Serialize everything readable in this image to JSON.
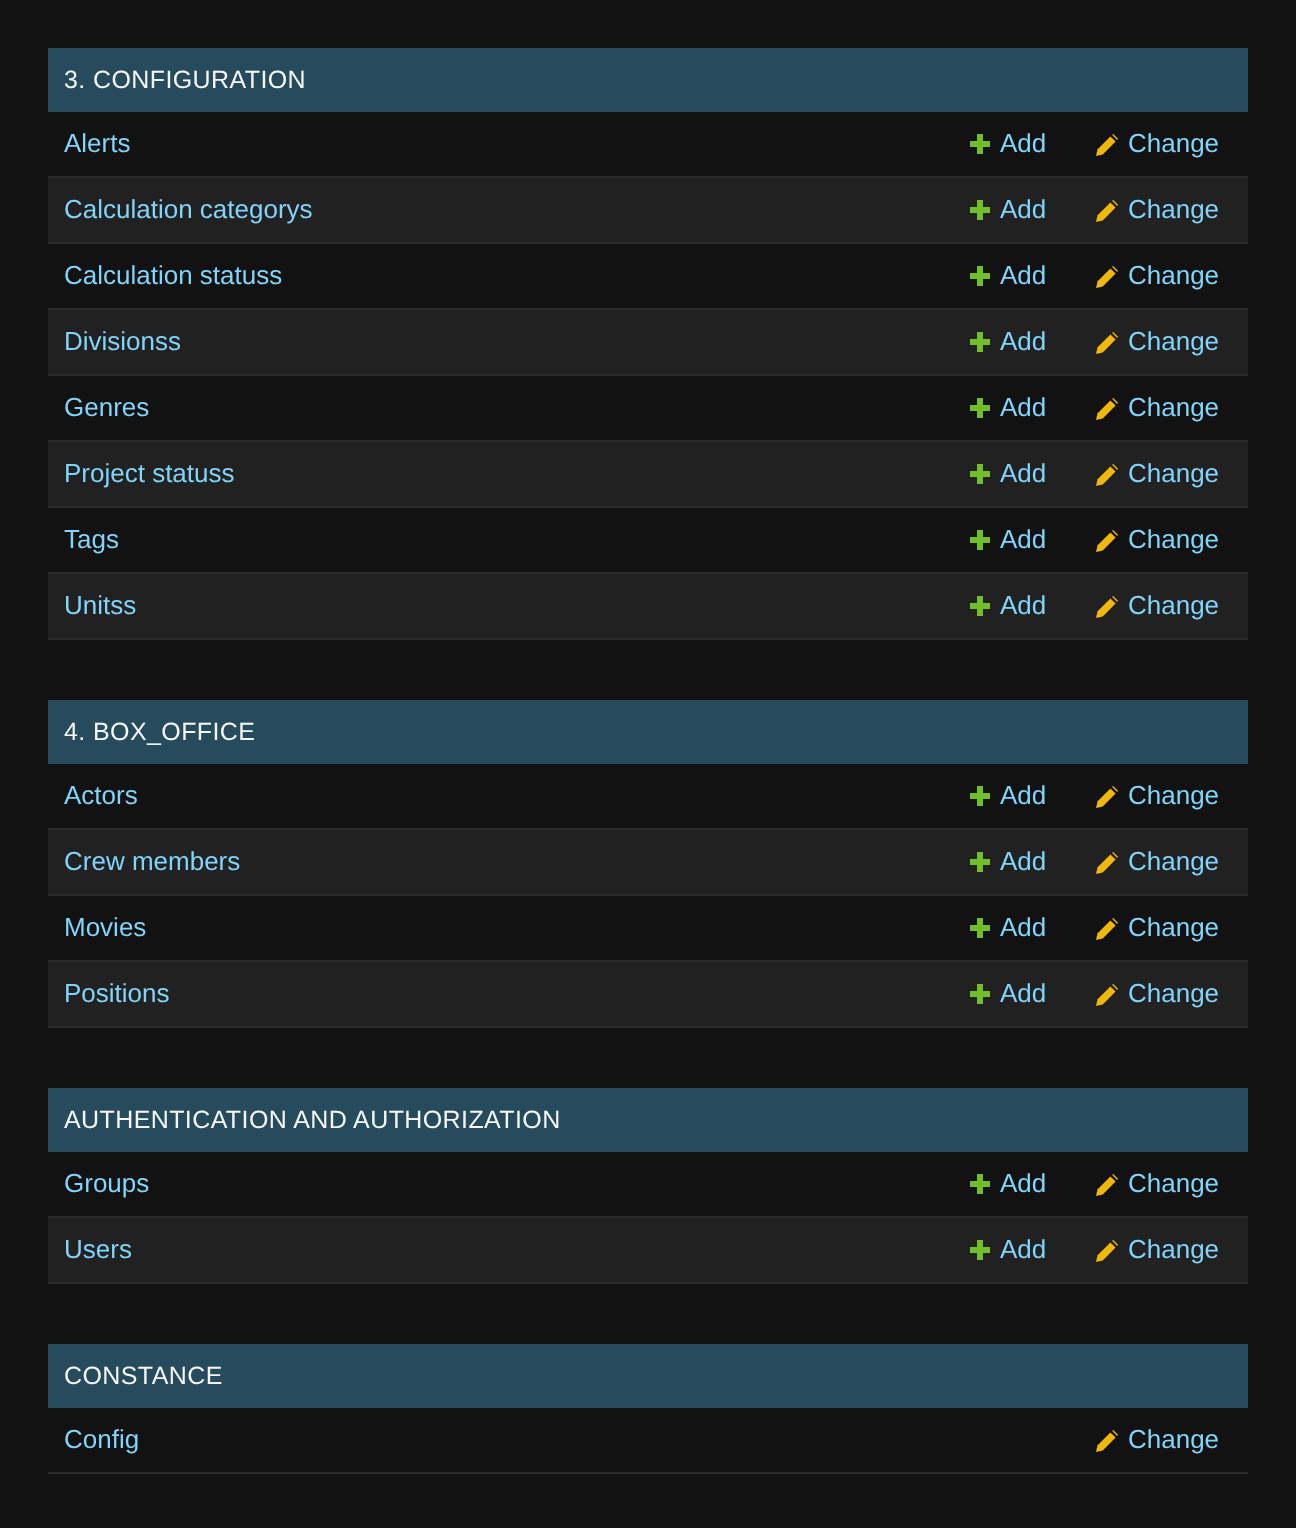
{
  "modules": [
    {
      "caption": "3. CONFIGURATION",
      "models": [
        {
          "name": "Alerts",
          "add": "Add",
          "change": "Change"
        },
        {
          "name": "Calculation categorys",
          "add": "Add",
          "change": "Change"
        },
        {
          "name": "Calculation statuss",
          "add": "Add",
          "change": "Change"
        },
        {
          "name": "Divisionss",
          "add": "Add",
          "change": "Change"
        },
        {
          "name": "Genres",
          "add": "Add",
          "change": "Change"
        },
        {
          "name": "Project statuss",
          "add": "Add",
          "change": "Change"
        },
        {
          "name": "Tags",
          "add": "Add",
          "change": "Change"
        },
        {
          "name": "Unitss",
          "add": "Add",
          "change": "Change"
        }
      ]
    },
    {
      "caption": "4. BOX_OFFICE",
      "models": [
        {
          "name": "Actors",
          "add": "Add",
          "change": "Change"
        },
        {
          "name": "Crew members",
          "add": "Add",
          "change": "Change"
        },
        {
          "name": "Movies",
          "add": "Add",
          "change": "Change"
        },
        {
          "name": "Positions",
          "add": "Add",
          "change": "Change"
        }
      ]
    },
    {
      "caption": "AUTHENTICATION AND AUTHORIZATION",
      "models": [
        {
          "name": "Groups",
          "add": "Add",
          "change": "Change"
        },
        {
          "name": "Users",
          "add": "Add",
          "change": "Change"
        }
      ]
    },
    {
      "caption": "CONSTANCE",
      "models": [
        {
          "name": "Config",
          "change": "Change"
        }
      ]
    }
  ]
}
